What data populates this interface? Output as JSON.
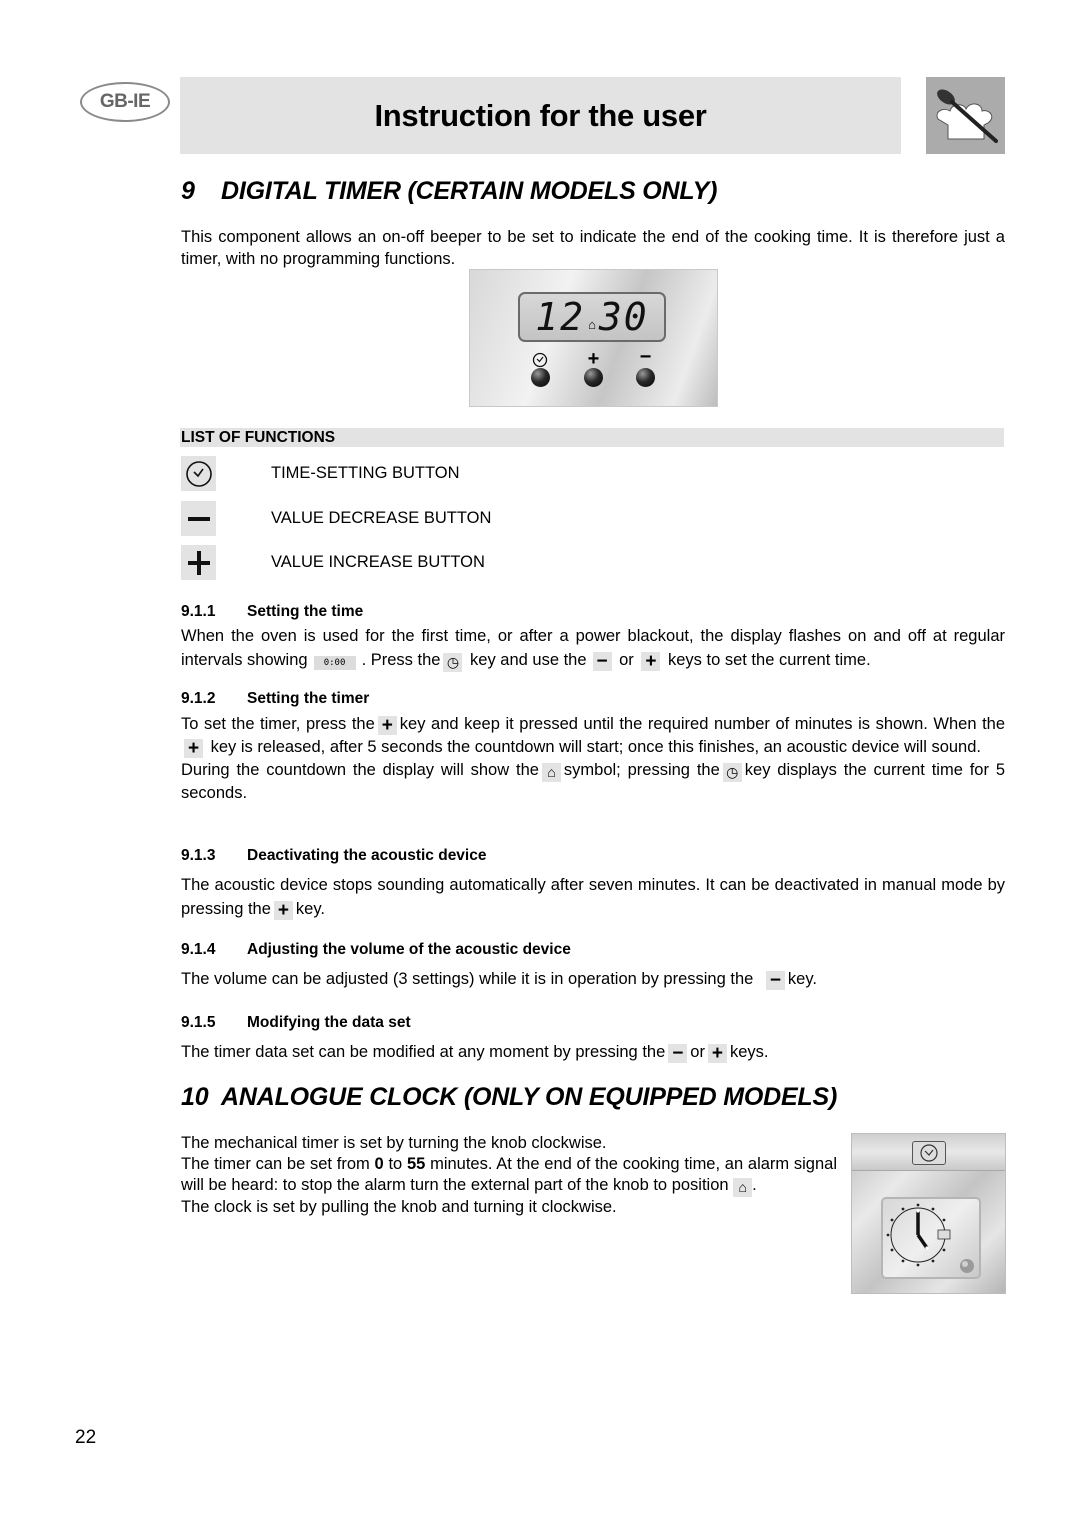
{
  "header": {
    "logo": "GB-IE",
    "title": "Instruction for the user",
    "chef_icon": "chef-hat-spoon-icon"
  },
  "section9": {
    "number": "9",
    "title": "DIGITAL TIMER (CERTAIN MODELS ONLY)",
    "intro": "This component allows an on-off beeper to be set to indicate the end of the cooking time.  It is therefore just a timer, with no programming functions.",
    "panel": {
      "display_left": "12",
      "display_right": "30",
      "bell_symbol": "bell-icon",
      "keys": [
        {
          "icon": "clock-icon",
          "symbol": "⏲"
        },
        {
          "icon": "plus-icon",
          "symbol": "+"
        },
        {
          "icon": "minus-icon",
          "symbol": "−"
        }
      ]
    },
    "list_of_functions": {
      "title": "LIST OF FUNCTIONS",
      "items": [
        {
          "icon": "clock-icon",
          "label": "TIME-SETTING BUTTON"
        },
        {
          "icon": "minus-icon",
          "label": "VALUE DECREASE BUTTON"
        },
        {
          "icon": "plus-icon",
          "label": "VALUE INCREASE BUTTON"
        }
      ]
    },
    "subsections": [
      {
        "number": "9.1.1",
        "title": "Setting the time",
        "text_1": "When the oven is used for the first time, or after a power blackout, the display flashes on and off at regular intervals showing",
        "display_value": "0:00",
        "text_2": ". Press the",
        "text_3": "key and use the",
        "text_4": "or",
        "text_5": "keys to set the current time."
      },
      {
        "number": "9.1.2",
        "title": "Setting the timer",
        "text_1": "To set the timer, press the",
        "text_2": "key and keep it pressed until the required number of minutes is shown. When the",
        "text_3": "key is released, after 5 seconds the countdown will start; once this finishes, an acoustic device will sound.",
        "text_4": "During the countdown the display will show the",
        "text_5": "symbol; pressing the",
        "text_6": "key displays the current time for 5 seconds."
      },
      {
        "number": "9.1.3",
        "title": "Deactivating the acoustic device",
        "text_1": "The acoustic device stops sounding automatically after seven minutes.  It can be deactivated in manual mode by pressing the",
        "text_2": "key."
      },
      {
        "number": "9.1.4",
        "title": "Adjusting the volume of the acoustic device",
        "text_1": "The volume can be adjusted (3 settings) while it is in operation by pressing the",
        "text_2": "key."
      },
      {
        "number": "9.1.5",
        "title": "Modifying the data set",
        "text_1": "The timer data set can be modified at any moment by pressing the",
        "text_2": "or",
        "text_3": "keys."
      }
    ]
  },
  "section10": {
    "number": "10",
    "title": "ANALOGUE CLOCK (ONLY ON EQUIPPED MODELS)",
    "line_1": "The mechanical timer is set by turning the knob clockwise.",
    "line_2a": "The timer can be set from",
    "line_2_from": "0",
    "line_2b": "to",
    "line_2_to": "55",
    "line_2c": "minutes. At the end of the cooking time, an alarm signal will be heard: to stop the alarm turn the external part of the knob to position",
    "line_2d": ".",
    "line_3": "The clock is set by pulling the knob and turning it clockwise."
  },
  "footer": {
    "page_number": "22"
  }
}
